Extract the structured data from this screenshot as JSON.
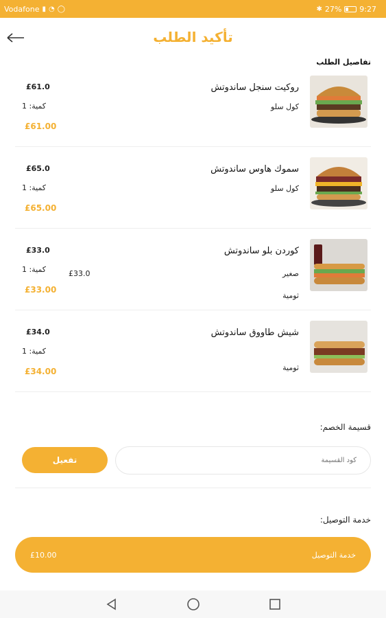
{
  "statusbar": {
    "carrier": "Vodafone",
    "battery": "27%",
    "time": "9:27"
  },
  "header": {
    "title": "تأكيد الطلب",
    "back_icon": "back-arrow-icon"
  },
  "section": {
    "order_details": "تفاصيل الطلب"
  },
  "items": [
    {
      "name": "روكيت سنجل ساندوتش",
      "options": [
        {
          "label": "كول سلو",
          "price": ""
        }
      ],
      "unit_price": "£61.0",
      "qty_label": "كمية: 1",
      "total": "£61.00"
    },
    {
      "name": "سموك هاوس ساندوتش",
      "options": [
        {
          "label": "كول سلو",
          "price": ""
        }
      ],
      "unit_price": "£65.0",
      "qty_label": "كمية: 1",
      "total": "£65.00"
    },
    {
      "name": "كوردن بلو ساندوتش",
      "options": [
        {
          "label": "صغير",
          "price": "£33.0"
        },
        {
          "label": "ثومية",
          "price": ""
        }
      ],
      "unit_price": "£33.0",
      "qty_label": "كمية: 1",
      "total": "£33.00"
    },
    {
      "name": "شيش طاووق ساندوتش",
      "options": [
        {
          "label": "ثومية",
          "price": ""
        }
      ],
      "unit_price": "£34.0",
      "qty_label": "كمية: 1",
      "total": "£34.00"
    }
  ],
  "coupon": {
    "label": "قسيمة الخصم:",
    "placeholder": "كود القسيمة",
    "apply_label": "تفعيل"
  },
  "delivery": {
    "label": "خدمة التوصيل:",
    "bar_label": "خدمة التوصيل",
    "bar_price": "£10.00"
  },
  "colors": {
    "accent": "#F4B133"
  }
}
